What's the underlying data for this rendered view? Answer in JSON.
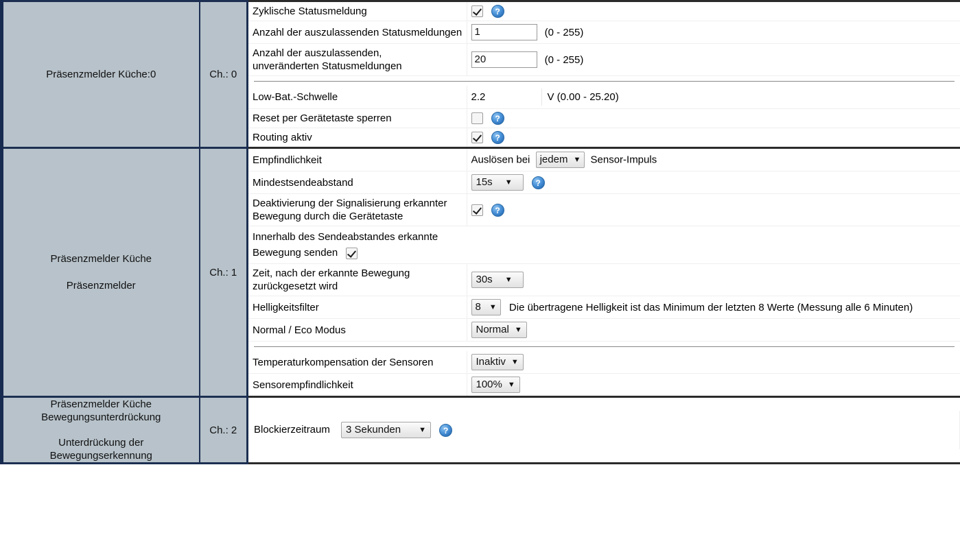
{
  "channels": [
    {
      "name": "Präsenzmelder Küche:0",
      "subtitle": "",
      "channel_label": "Ch.: 0",
      "rows": [
        {
          "label": "Zyklische Statusmeldung",
          "widget": "checkbox",
          "checked": true,
          "help": true
        },
        {
          "label": "Anzahl der auszulassenden Statusmeldungen",
          "widget": "text",
          "value": "1",
          "unit": "(0 - 255)"
        },
        {
          "label": "Anzahl der auszulassenden,\nunveränderten Statusmeldungen",
          "label_line1": "Anzahl der auszulassenden,",
          "label_line2": "unveränderten Statusmeldungen",
          "widget": "text",
          "value": "20",
          "unit": "(0 - 255)"
        },
        {
          "widget": "separator"
        },
        {
          "label": "Low-Bat.-Schwelle",
          "widget": "plainvalue",
          "value": "2.2",
          "unit": "V (0.00 - 25.20)"
        },
        {
          "label": "Reset per Gerätetaste sperren",
          "widget": "checkbox",
          "checked": false,
          "help": true
        },
        {
          "label": "Routing aktiv",
          "widget": "checkbox",
          "checked": true,
          "help": true
        }
      ]
    },
    {
      "name": "Präsenzmelder Küche",
      "subtitle": "Präsenzmelder",
      "channel_label": "Ch.: 1",
      "rows": [
        {
          "label": "Empfindlichkeit",
          "widget": "select_inline",
          "prefix": "Auslösen bei",
          "value": "jedem",
          "suffix": "Sensor-Impuls"
        },
        {
          "label": "Mindestsendeabstand",
          "widget": "select",
          "value": "15s",
          "help": true
        },
        {
          "label_line1": "Deaktivierung der Signalisierung erkannter",
          "label_line2": "Bewegung durch die Gerätetaste",
          "widget": "checkbox",
          "checked": true,
          "help": true
        },
        {
          "label": "Innerhalb des Sendeabstandes erkannte",
          "widget": "none"
        },
        {
          "label": "Bewegung senden",
          "widget": "checkbox_inline",
          "checked": true
        },
        {
          "label_line1": "Zeit, nach der erkannte Bewegung",
          "label_line2": "zurückgesetzt wird",
          "widget": "select",
          "value": "30s"
        },
        {
          "label": "Helligkeitsfilter",
          "widget": "select_note",
          "value": "8",
          "note": "Die übertragene Helligkeit ist das Minimum der letzten 8 Werte (Messung alle 6 Minuten)"
        },
        {
          "label": "Normal / Eco Modus",
          "widget": "select",
          "value": "Normal"
        },
        {
          "widget": "separator"
        },
        {
          "label": "Temperaturkompensation der Sensoren",
          "widget": "select",
          "value": "Inaktiv"
        },
        {
          "label": "Sensorempfindlichkeit",
          "widget": "select",
          "value": "100%"
        }
      ]
    },
    {
      "name_line1": "Präsenzmelder Küche",
      "name_line2": "Bewegungsunterdrückung",
      "sub_line1": "Unterdrückung der",
      "sub_line2": "Bewegungserkennung",
      "channel_label": "Ch.: 2",
      "rows": [
        {
          "label": "Blockierzeitraum",
          "widget": "select_narrowlabel",
          "value": "3 Sekunden",
          "help": true
        }
      ]
    }
  ],
  "icons": {
    "help": "?",
    "dropdown_arrow": "▼",
    "help_icon_name": "help-icon"
  },
  "colors": {
    "sidebar_bg": "#b7c2ca",
    "sidebar_border": "#1c2f52",
    "help_blue": "#2a6aa8"
  }
}
